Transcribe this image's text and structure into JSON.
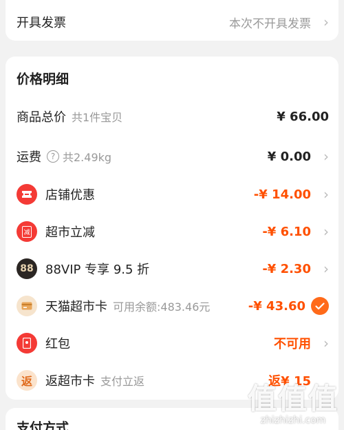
{
  "invoice": {
    "label": "开具发票",
    "value": "本次不开具发票"
  },
  "price_detail": {
    "title": "价格明细",
    "items": [
      {
        "label": "商品总价",
        "sub": "共1件宝贝",
        "value": "¥ 66.00"
      },
      {
        "label": "运费",
        "sub": "共2.49kg",
        "value": "¥ 0.00"
      },
      {
        "label": "店铺优惠",
        "value": "-¥ 14.00",
        "icon": "shop-coupon-icon"
      },
      {
        "label": "超市立减",
        "value": "-¥ 6.10",
        "icon": "supermarket-discount-icon",
        "icon_text": "减"
      },
      {
        "label": "88VIP 专享 9.5 折",
        "value": "-¥ 2.30",
        "icon": "88vip-icon",
        "icon_text": "88"
      },
      {
        "label": "天猫超市卡",
        "sub": "可用余额:483.46元",
        "value": "-¥ 43.60",
        "icon": "tmall-card-icon",
        "selected": true
      },
      {
        "label": "红包",
        "value": "不可用",
        "icon": "red-packet-icon"
      },
      {
        "label": "返超市卡",
        "sub": "支付立返",
        "value": "返¥ 15",
        "icon": "cashback-icon",
        "icon_text": "返"
      }
    ]
  },
  "payment": {
    "title": "支付方式"
  },
  "watermark": {
    "big": "值值值",
    "small": "zhizhizhi.com"
  },
  "colors": {
    "accent": "#ff5000",
    "red": "#f43a35",
    "background": "#f2f2f2"
  }
}
